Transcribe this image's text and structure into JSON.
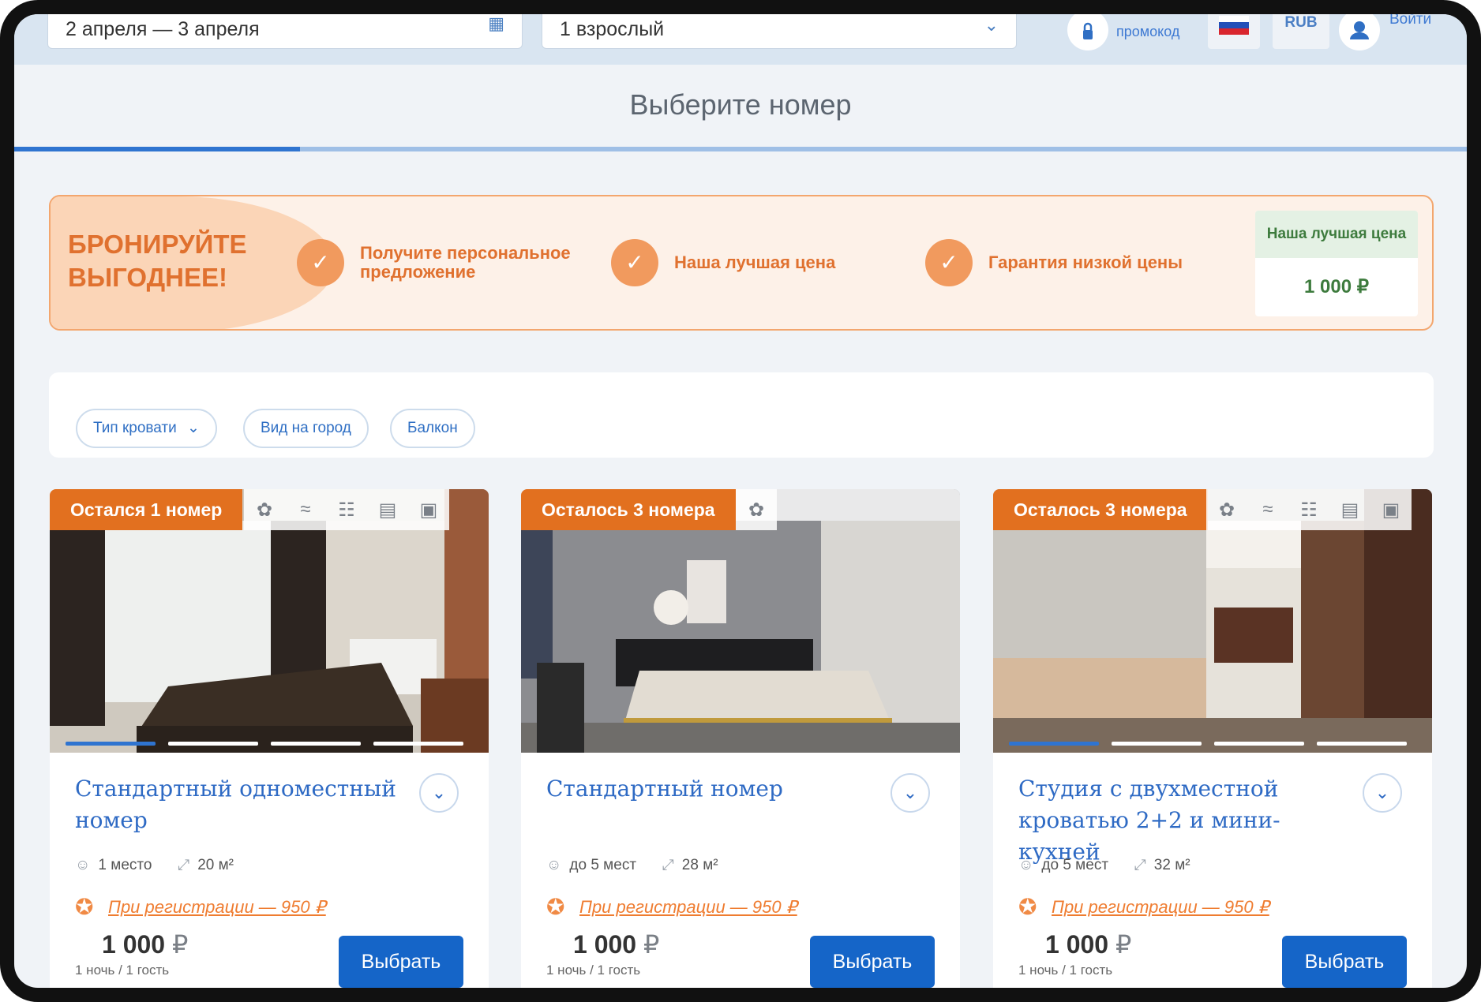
{
  "search": {
    "dates": "2 апреля — 3 апреля",
    "guests": "1 взрослый",
    "promo_label": "промокод",
    "currency": "RUB",
    "login_label": "Войти"
  },
  "page_title": "Выберите номер",
  "progress": {
    "step_fraction": 0.2
  },
  "promo": {
    "heading": "БРОНИРУЙТЕ ВЫГОДНЕЕ!",
    "benefits": [
      {
        "text": "Получите персональное предложение"
      },
      {
        "text": "Наша лучшая цена"
      },
      {
        "text": "Гарантия низкой цены"
      }
    ],
    "best_price_label": "Наша лучшая цена",
    "best_price": "1 000 ₽"
  },
  "filters": [
    {
      "label": "Тип кровати"
    },
    {
      "label": "Вид на город"
    },
    {
      "label": "Балкон"
    }
  ],
  "rooms": [
    {
      "badge": "Остался 1 номер",
      "amenities": [
        "paw-icon",
        "wifi-icon",
        "air-conditioner-icon",
        "bed-icon",
        "safe-icon"
      ],
      "title": "Стандартный одноместный номер",
      "capacity": "1 место",
      "area": "20 м²",
      "registration_offer": "При регистрации — 950 ₽",
      "price": "1 000",
      "currency": "₽",
      "per": "1 ночь / 1 гость",
      "select_label": "Выбрать"
    },
    {
      "badge": "Осталось 3 номера",
      "amenities": [
        "paw-icon"
      ],
      "title": "Стандартный номер",
      "capacity": "до 5 мест",
      "area": "28 м²",
      "registration_offer": "При регистрации — 950 ₽",
      "price": "1 000",
      "currency": "₽",
      "per": "1 ночь / 1 гость",
      "select_label": "Выбрать"
    },
    {
      "badge": "Осталось 3 номера",
      "amenities": [
        "paw-icon",
        "wifi-icon",
        "air-conditioner-icon",
        "bed-icon",
        "safe-icon"
      ],
      "title": "Студия с двухместной кроватью 2+2 и мини-кухней",
      "capacity": "до 5 мест",
      "area": "32 м²",
      "registration_offer": "При регистрации — 950 ₽",
      "price": "1 000",
      "currency": "₽",
      "per": "1 ночь / 1 гость",
      "select_label": "Выбрать"
    }
  ],
  "colors": {
    "accent_blue": "#1565c8",
    "brand_orange": "#e2701f",
    "promo_bg": "#fdf1e8",
    "best_price_green": "#3d7b3d"
  }
}
